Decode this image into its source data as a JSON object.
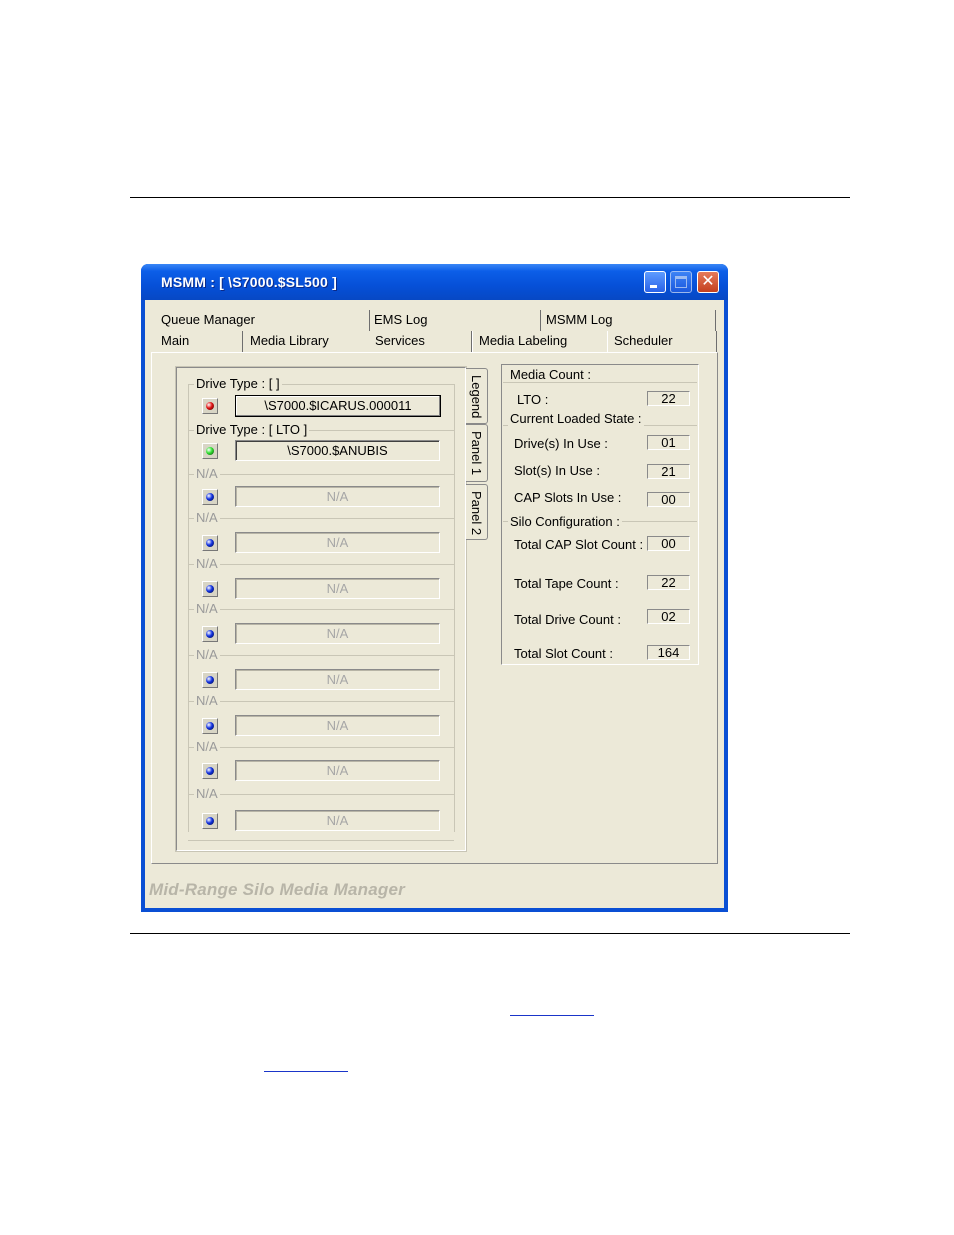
{
  "window": {
    "title": "MSMM : [ \\S7000.$SL500 ]",
    "footer": "Mid-Range Silo Media Manager",
    "close_glyph": "✕"
  },
  "tabs": {
    "row1": [
      "Queue Manager",
      "EMS Log",
      "MSMM Log"
    ],
    "row2": [
      "Main",
      "Media Library",
      "Services",
      "Media Labeling",
      "Scheduler"
    ],
    "active": "Services"
  },
  "side_tabs": [
    "Legend",
    "Panel 1",
    "Panel 2"
  ],
  "drives": [
    {
      "group": "Drive Type : [  ]",
      "name": "\\S7000.$ICARUS.000011",
      "led": "red",
      "led_color": "#e01010"
    },
    {
      "group": "Drive Type : [ LTO ]",
      "name": "\\S7000.$ANUBIS",
      "led": "green",
      "led_color": "#30e030"
    },
    {
      "group": "N/A",
      "name": "N/A",
      "led": "blue",
      "led_color": "#1030e0"
    },
    {
      "group": "N/A",
      "name": "N/A",
      "led": "blue",
      "led_color": "#1030e0"
    },
    {
      "group": "N/A",
      "name": "N/A",
      "led": "blue",
      "led_color": "#1030e0"
    },
    {
      "group": "N/A",
      "name": "N/A",
      "led": "blue",
      "led_color": "#1030e0"
    },
    {
      "group": "N/A",
      "name": "N/A",
      "led": "blue",
      "led_color": "#1030e0"
    },
    {
      "group": "N/A",
      "name": "N/A",
      "led": "blue",
      "led_color": "#1030e0"
    },
    {
      "group": "N/A",
      "name": "N/A",
      "led": "blue",
      "led_color": "#1030e0"
    },
    {
      "group": "N/A",
      "name": "N/A",
      "led": "blue",
      "led_color": "#1030e0"
    }
  ],
  "media_count": {
    "title": "Media Count :",
    "lto_label": "LTO :",
    "lto_value": "22"
  },
  "loaded_state": {
    "title": "Current Loaded State :",
    "drives_label": "Drive(s) In Use :",
    "drives_value": "01",
    "slots_label": "Slot(s) In Use :",
    "slots_value": "21",
    "cap_label": "CAP Slots In Use :",
    "cap_value": "00"
  },
  "silo_config": {
    "title": "Silo Configuration :",
    "cap_slot_label": "Total CAP Slot Count :",
    "cap_slot_value": "00",
    "tape_label": "Total Tape Count :",
    "tape_value": "22",
    "drive_label": "Total Drive Count :",
    "drive_value": "02",
    "slot_label": "Total Slot Count :",
    "slot_value": "164"
  }
}
